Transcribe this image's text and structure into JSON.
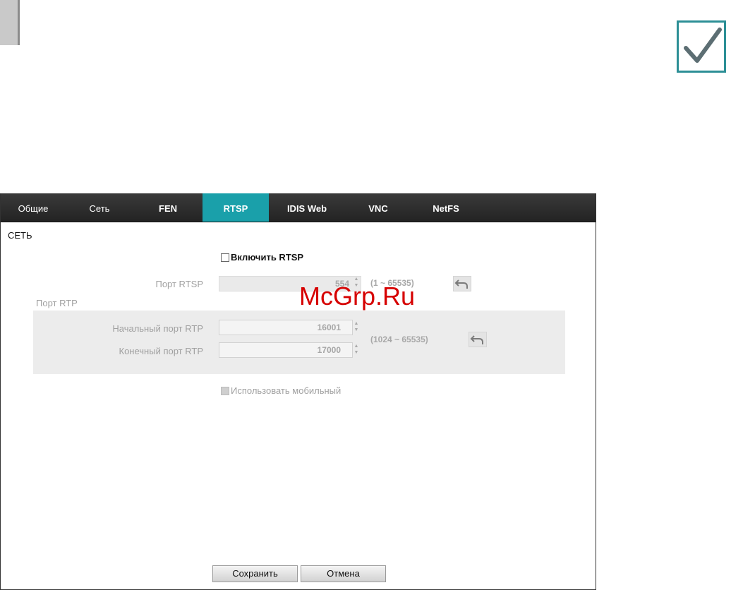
{
  "tabs": [
    {
      "label": "Общие",
      "active": false
    },
    {
      "label": "Сеть",
      "active": false
    },
    {
      "label": "FEN",
      "active": false
    },
    {
      "label": "RTSP",
      "active": true
    },
    {
      "label": "IDIS Web",
      "active": false
    },
    {
      "label": "VNC",
      "active": false
    },
    {
      "label": "NetFS",
      "active": false
    }
  ],
  "section_title": "СЕТЬ",
  "enable_rtsp": {
    "label": "Включить RTSP",
    "checked": false
  },
  "rtsp_port": {
    "label": "Порт RTSP",
    "value": "554",
    "range": "(1 ~ 65535)"
  },
  "rtp_group": {
    "title": "Порт RTP",
    "start": {
      "label": "Начальный порт RTP",
      "value": "16001"
    },
    "end": {
      "label": "Конечный порт RTP",
      "value": "17000"
    },
    "range": "(1024 ~ 65535)"
  },
  "use_mobile": {
    "label": "Использовать мобильный",
    "checked": false
  },
  "buttons": {
    "save": "Сохранить",
    "cancel": "Отмена"
  },
  "watermark": "McGrp.Ru",
  "colors": {
    "accent": "#1aa0aa",
    "note_icon": "#2c8f96",
    "watermark": "#d60000"
  },
  "icons": {
    "note": "checkmark-icon",
    "reset": "undo-arrow-icon"
  }
}
